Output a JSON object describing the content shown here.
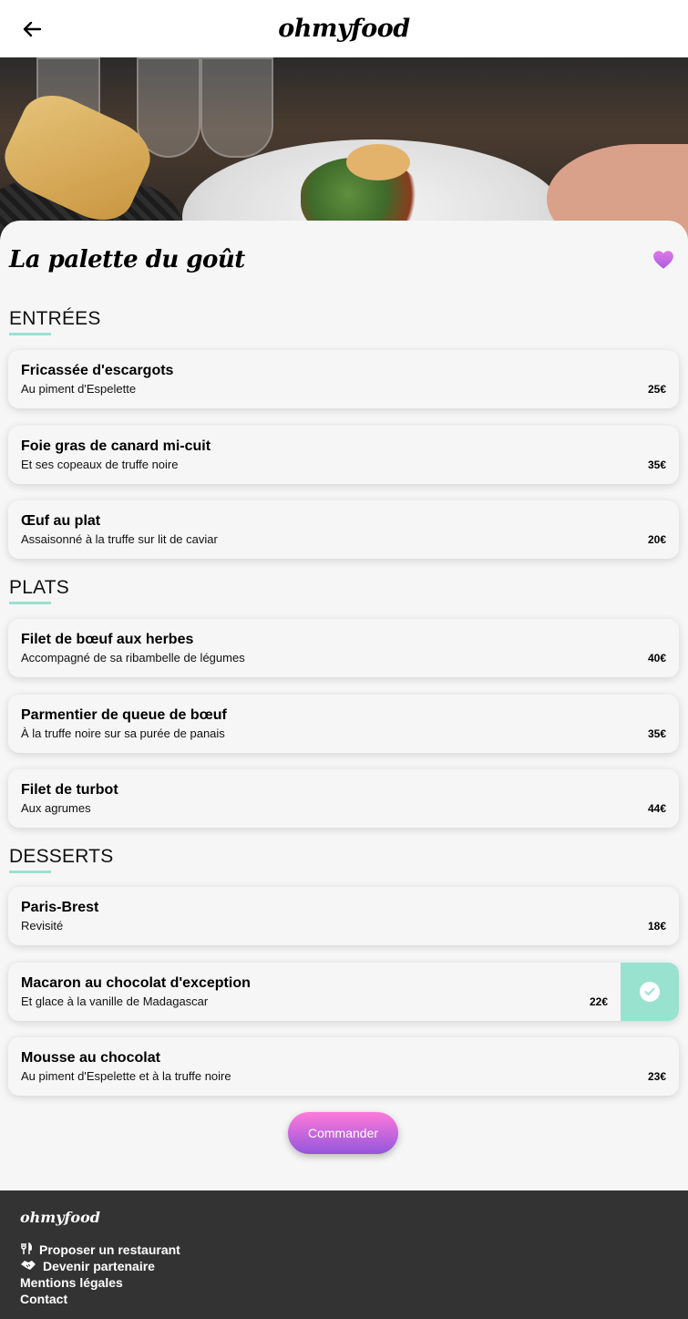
{
  "header": {
    "logo": "ohmyfood",
    "back_icon": "arrow-left-icon"
  },
  "restaurant": {
    "name": "La palette du goût",
    "favorite_icon": "heart-icon",
    "favorite_color": "#cc6ae0"
  },
  "sections": [
    {
      "title": "ENTRÉES",
      "dishes": [
        {
          "name": "Fricassée d'escargots",
          "desc": "Au piment d'Espelette",
          "price": "25€"
        },
        {
          "name": "Foie gras de canard mi-cuit",
          "desc": "Et ses copeaux de truffe noire",
          "price": "35€"
        },
        {
          "name": "Œuf au plat",
          "desc": "Assaisonné à la truffe sur lit de caviar",
          "price": "20€"
        }
      ]
    },
    {
      "title": "PLATS",
      "dishes": [
        {
          "name": "Filet de bœuf aux herbes",
          "desc": "Accompagné de sa ribambelle de légumes",
          "price": "40€"
        },
        {
          "name": "Parmentier de queue de bœuf",
          "desc": "À la truffe noire sur sa purée de panais",
          "price": "35€"
        },
        {
          "name": "Filet de turbot",
          "desc": "Aux agrumes",
          "price": "44€"
        }
      ]
    },
    {
      "title": "DESSERTS",
      "dishes": [
        {
          "name": "Paris-Brest",
          "desc": "Revisité",
          "price": "18€"
        },
        {
          "name": "Macaron au chocolat d'exception",
          "desc": "Et glace à la vanille de Madagascar",
          "price": "22€",
          "selected": true
        },
        {
          "name": "Mousse au chocolat",
          "desc": "Au piment d'Espelette et à la truffe noire",
          "price": "23€"
        }
      ]
    }
  ],
  "order_button": "Commander",
  "colors": {
    "accent": "#99e2d0",
    "button_top": "#ff79da",
    "button_bottom": "#9356dc",
    "footer_bg": "#333333"
  },
  "footer": {
    "logo": "ohmyfood",
    "links": [
      {
        "label": "Proposer un restaurant",
        "icon": "utensils-icon"
      },
      {
        "label": "Devenir partenaire",
        "icon": "handshake-icon"
      },
      {
        "label": "Mentions légales",
        "icon": ""
      },
      {
        "label": "Contact",
        "icon": ""
      }
    ]
  }
}
